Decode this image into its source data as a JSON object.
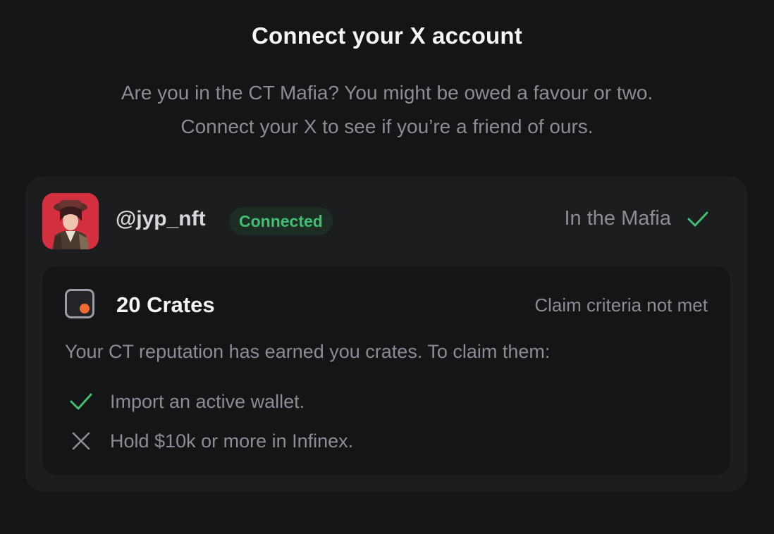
{
  "header": {
    "title": "Connect your X account",
    "subtitle_line1": "Are you in the CT Mafia? You might be owed a favour or two.",
    "subtitle_line2": "Connect your X to see if you’re a friend of ours."
  },
  "account": {
    "handle": "@jyp_nft",
    "badge": "Connected",
    "mafia_status": "In the Mafia",
    "mafia_icon": "check-icon",
    "avatar_icon": "avatar-image"
  },
  "crates": {
    "icon": "crate-icon",
    "count_label": "20 Crates",
    "claim_status": "Claim criteria not met",
    "description": "Your CT reputation has earned you crates. To claim them:",
    "criteria": [
      {
        "label": "Import an active wallet.",
        "met": true,
        "icon": "check-icon"
      },
      {
        "label": "Hold $10k or more in Infinex.",
        "met": false,
        "icon": "x-icon"
      }
    ]
  },
  "colors": {
    "background": "#141516",
    "card": "#1c1d1f",
    "inner_card": "#141517",
    "success": "#3fbf71",
    "badge_bg": "#1d2d24",
    "muted_text": "#8a8d93",
    "crate_dot": "#f26b2f",
    "avatar_bg": "#d4303f"
  }
}
